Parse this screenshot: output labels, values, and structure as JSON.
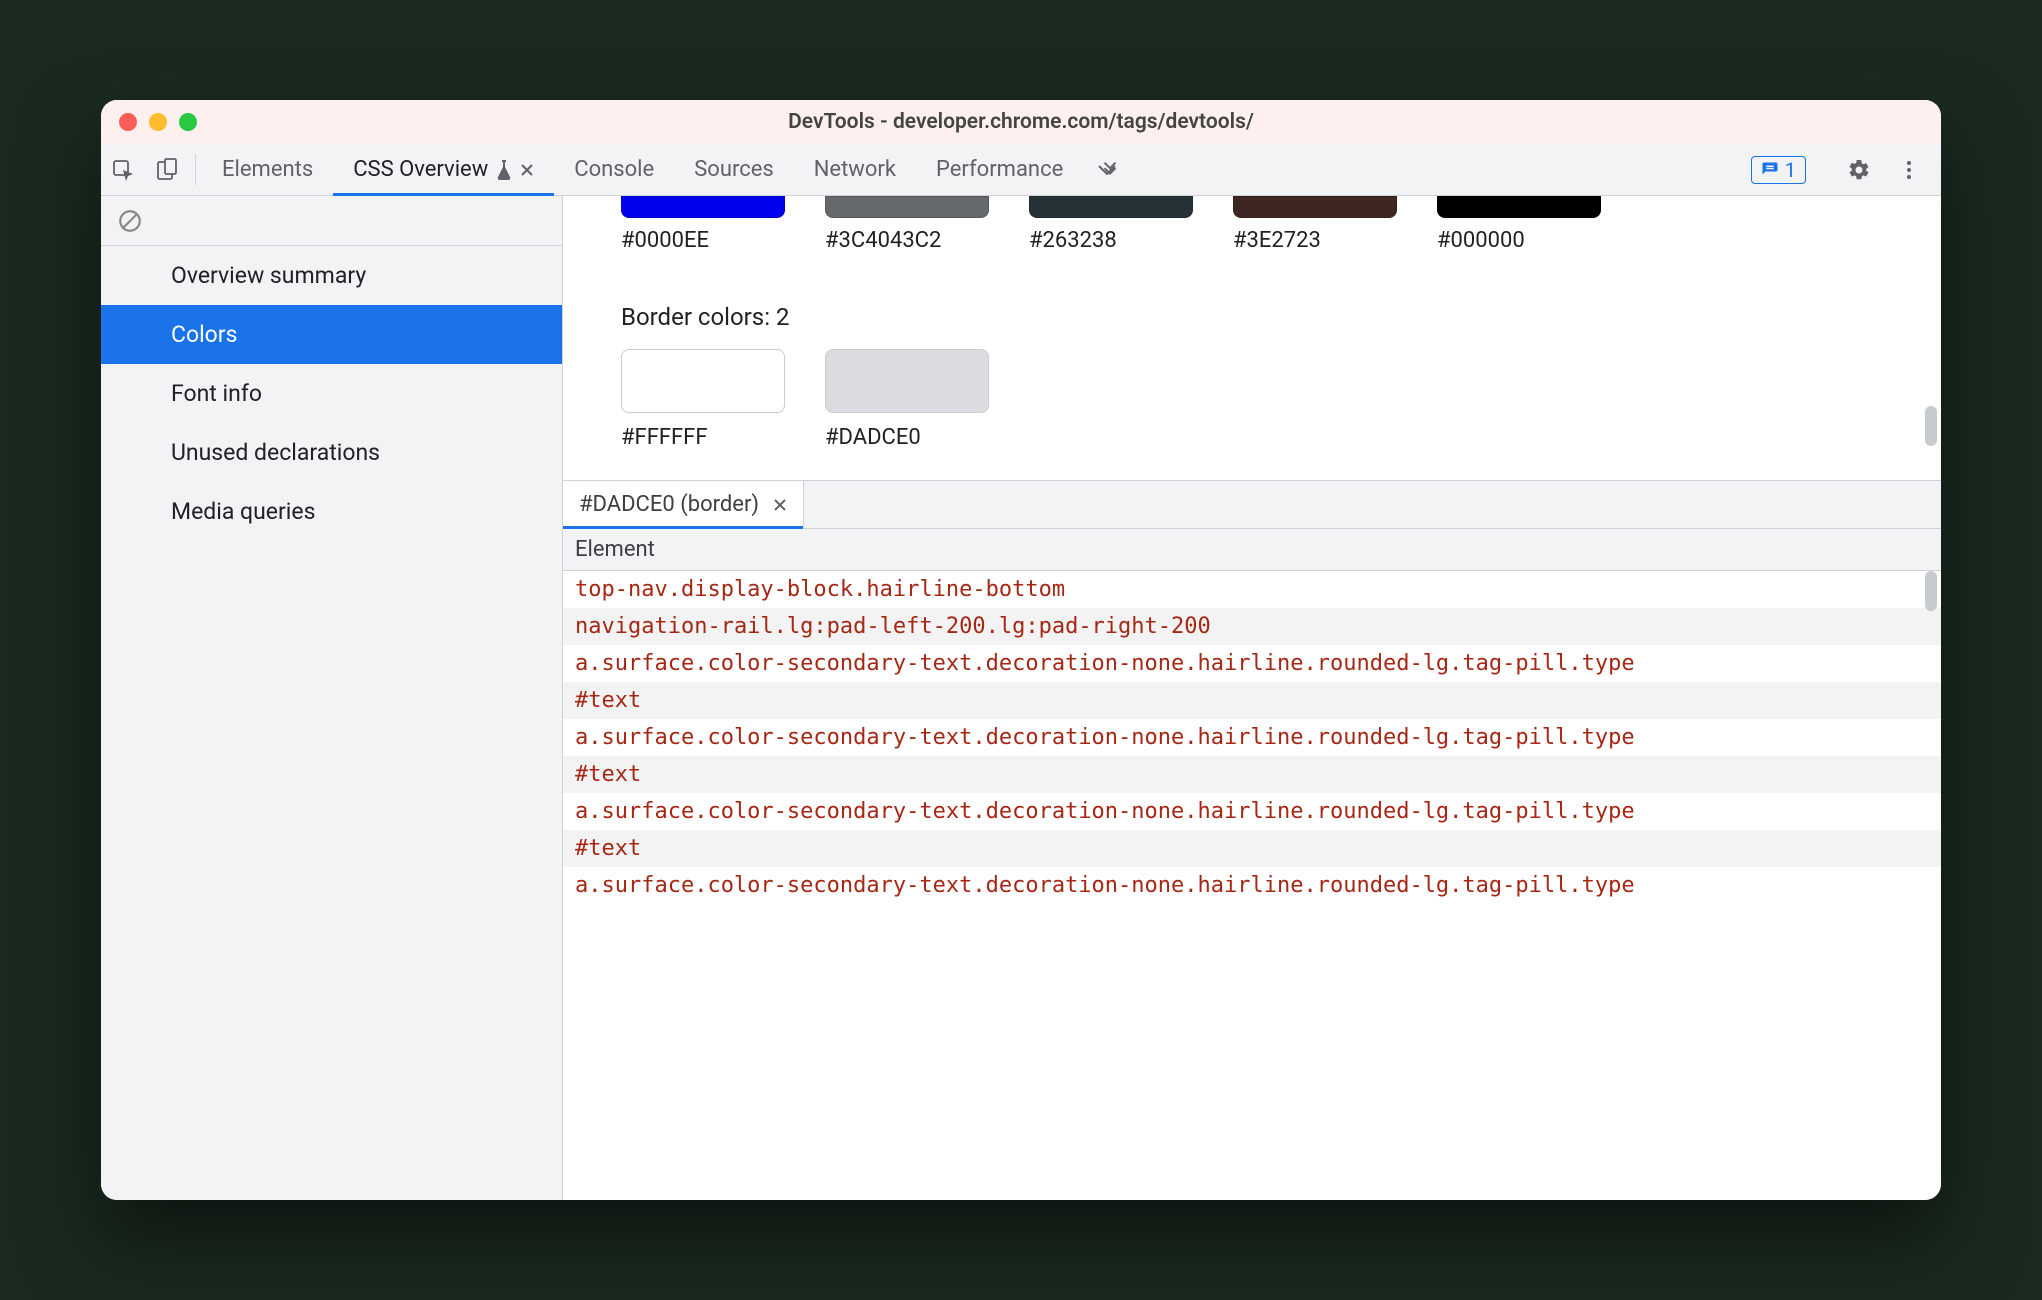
{
  "window": {
    "title": "DevTools - developer.chrome.com/tags/devtools/"
  },
  "toolbar": {
    "tabs": {
      "elements": "Elements",
      "css_overview": "CSS Overview",
      "console": "Console",
      "sources": "Sources",
      "network": "Network",
      "performance": "Performance"
    },
    "issues_count": "1"
  },
  "sidebar": {
    "items": [
      "Overview summary",
      "Colors",
      "Font info",
      "Unused declarations",
      "Media queries"
    ]
  },
  "colors_row1": [
    {
      "hex": "#0000EE",
      "bg": "#0000EE"
    },
    {
      "hex": "#3C4043C2",
      "bg": "#66696C"
    },
    {
      "hex": "#263238",
      "bg": "#263238"
    },
    {
      "hex": "#3E2723",
      "bg": "#3E2723"
    },
    {
      "hex": "#000000",
      "bg": "#000000"
    }
  ],
  "border_section": {
    "title": "Border colors: 2",
    "swatches": [
      {
        "hex": "#FFFFFF",
        "bg": "#FFFFFF"
      },
      {
        "hex": "#DADCE0",
        "bg": "#DADCE0"
      }
    ]
  },
  "detail_tab": {
    "label": "#DADCE0 (border)"
  },
  "detail_header": "Element",
  "elements": [
    "top-nav.display-block.hairline-bottom",
    "navigation-rail.lg:pad-left-200.lg:pad-right-200",
    "a.surface.color-secondary-text.decoration-none.hairline.rounded-lg.tag-pill.type",
    "#text",
    "a.surface.color-secondary-text.decoration-none.hairline.rounded-lg.tag-pill.type",
    "#text",
    "a.surface.color-secondary-text.decoration-none.hairline.rounded-lg.tag-pill.type",
    "#text",
    "a.surface.color-secondary-text.decoration-none.hairline.rounded-lg.tag-pill.type"
  ]
}
